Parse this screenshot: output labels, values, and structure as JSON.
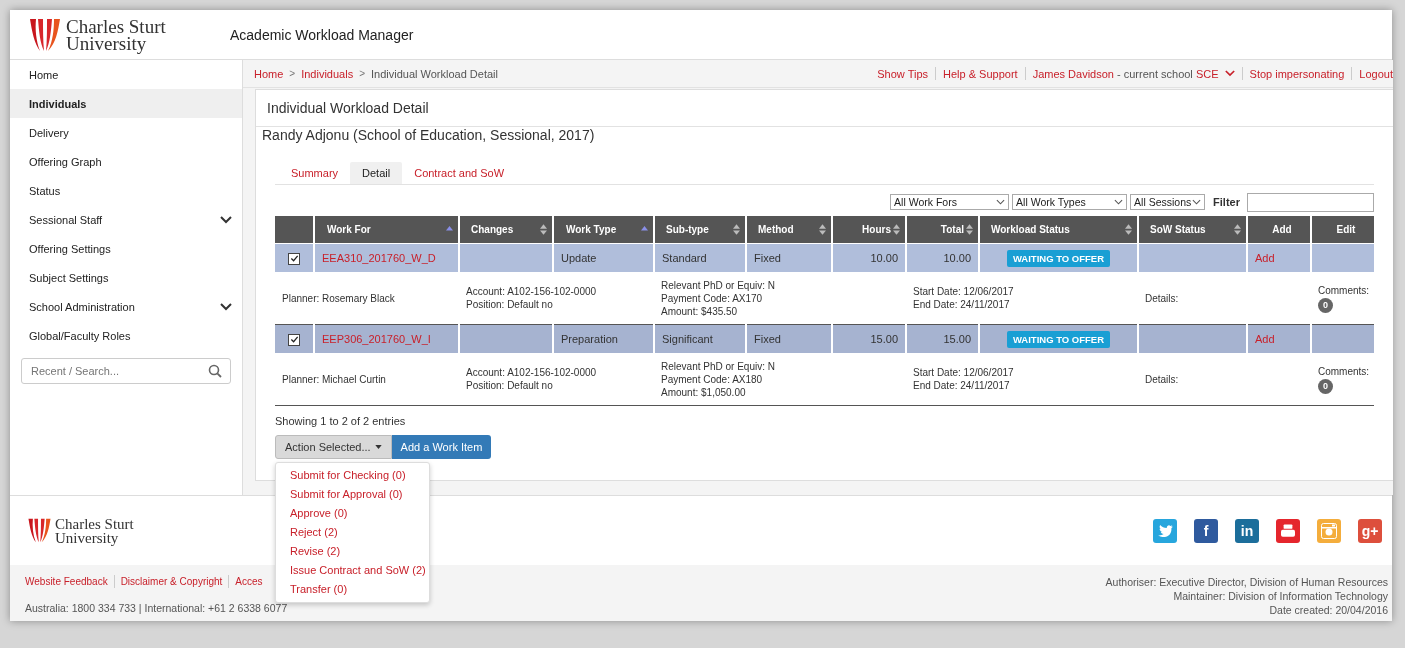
{
  "header": {
    "logo": [
      "Charles Sturt",
      "University"
    ],
    "app_title": "Academic Workload Manager"
  },
  "sidebar": {
    "items": [
      {
        "label": "Home",
        "selected": false
      },
      {
        "label": "Individuals",
        "selected": true
      },
      {
        "label": "Delivery",
        "selected": false
      },
      {
        "label": "Offering Graph",
        "selected": false
      },
      {
        "label": "Status",
        "selected": false
      },
      {
        "label": "Sessional Staff",
        "selected": false,
        "expanded": false
      },
      {
        "label": "Offering Settings",
        "selected": false
      },
      {
        "label": "Subject Settings",
        "selected": false
      },
      {
        "label": "School Administration",
        "selected": false,
        "expanded": false
      },
      {
        "label": "Global/Faculty Roles",
        "selected": false
      }
    ],
    "search": {
      "placeholder": "Recent / Search..."
    }
  },
  "breadcrumb": {
    "separator": ">",
    "items": [
      {
        "label": "Home",
        "link": true
      },
      {
        "label": "Individuals",
        "link": true
      },
      {
        "label": "Individual Workload Detail",
        "link": false
      }
    ]
  },
  "top_links": [
    {
      "label": "Show Tips"
    },
    {
      "label": "Help & Support"
    },
    {
      "kind": "user",
      "name": "James Davidson",
      "context": " - current school ",
      "school": "SCE"
    },
    {
      "label": "Stop impersonating"
    },
    {
      "label": "Logout"
    }
  ],
  "panel_title": "Individual Workload Detail",
  "person": "Randy Adjonu (School of Education, Sessional, 2017)",
  "tabs": [
    {
      "label": "Summary",
      "selected": false
    },
    {
      "label": "Detail",
      "selected": true
    },
    {
      "label": "Contract and SoW",
      "selected": false
    }
  ],
  "filters": {
    "selects": [
      "All Work Fors",
      "All Work Types",
      "All Sessions"
    ],
    "filter_label": "Filter"
  },
  "table": {
    "columns": [
      {
        "sortable": false
      },
      {
        "label": "Work For",
        "sortable": true,
        "sorted": true
      },
      {
        "label": "Changes",
        "sortable": true,
        "sorted": false
      },
      {
        "label": "Work Type",
        "sortable": true,
        "sorted": true
      },
      {
        "label": "Sub-type",
        "sortable": true,
        "sorted": false
      },
      {
        "label": "Method",
        "sortable": true,
        "sorted": false
      },
      {
        "label": "Hours",
        "sortable": true,
        "sorted": false
      },
      {
        "label": "Total",
        "sortable": true,
        "sorted": false
      },
      {
        "label": "Workload Status",
        "sortable": true,
        "sorted": false
      },
      {
        "label": "SoW Status",
        "sortable": true,
        "sorted": false
      },
      {
        "label": "Add",
        "sortable": false
      },
      {
        "label": "Edit",
        "sortable": false
      }
    ],
    "rows": [
      {
        "checked": true,
        "work_for": "EEA310_201760_W_D",
        "work_type": "Update",
        "sub_type": "Standard",
        "method": "Fixed",
        "hours": "10.00",
        "total": "10.00",
        "status": "WAITING TO OFFER",
        "add": "Add",
        "planner": "Planner: Rosemary Black",
        "account": [
          "Account: A102-156-102-0000",
          "Position: Default no"
        ],
        "payment": [
          "Relevant PhD or Equiv: N",
          "Payment Code: AX170",
          "Amount: $435.50"
        ],
        "dates": [
          "Start Date: 12/06/2017",
          "End Date: 24/11/2017"
        ],
        "details": "Details:",
        "comments_label": "Comments:",
        "comments": "0"
      },
      {
        "checked": true,
        "work_for": "EEP306_201760_W_I",
        "work_type": "Preparation",
        "sub_type": "Significant",
        "method": "Fixed",
        "hours": "15.00",
        "total": "15.00",
        "status": "WAITING TO OFFER",
        "add": "Add",
        "planner": "Planner: Michael Curtin",
        "account": [
          "Account: A102-156-102-0000",
          "Position: Default no"
        ],
        "payment": [
          "Relevant PhD or Equiv: N",
          "Payment Code: AX180",
          "Amount: $1,050.00"
        ],
        "dates": [
          "Start Date: 12/06/2017",
          "End Date: 24/11/2017"
        ],
        "details": "Details:",
        "comments_label": "Comments:",
        "comments": "0"
      }
    ]
  },
  "showing": "Showing 1 to 2 of 2 entries",
  "action_button": "Action Selected...",
  "add_button": "Add a Work Item",
  "action_menu": [
    "Submit for Checking (0)",
    "Submit for Approval (0)",
    "Approve (0)",
    "Reject (2)",
    "Revise (2)",
    "Issue Contract and SoW (2)",
    "Transfer (0)"
  ],
  "footer": {
    "logo": [
      "Charles Sturt",
      "University"
    ],
    "social": [
      {
        "kind": "bird",
        "color": "#27a6dd"
      },
      {
        "kind": "letter",
        "glyph": "f",
        "color": "#2f5a9e"
      },
      {
        "kind": "letter",
        "glyph": "in",
        "color": "#1c6e9b"
      },
      {
        "kind": "play",
        "color": "#e5262d"
      },
      {
        "kind": "camera",
        "color": "#f4ad3c"
      },
      {
        "kind": "letter",
        "glyph": "g+",
        "color": "#dd4f3c"
      }
    ],
    "links": [
      "Website Feedback",
      "Disclaimer & Copyright",
      "Acces"
    ],
    "phone": "Australia: 1800 334 733 | International: +61 2 6338 6077",
    "info": [
      "Authoriser: Executive Director, Division of Human Resources",
      "Maintainer: Division of Information Technology",
      "Date created: 20/04/2016"
    ]
  }
}
